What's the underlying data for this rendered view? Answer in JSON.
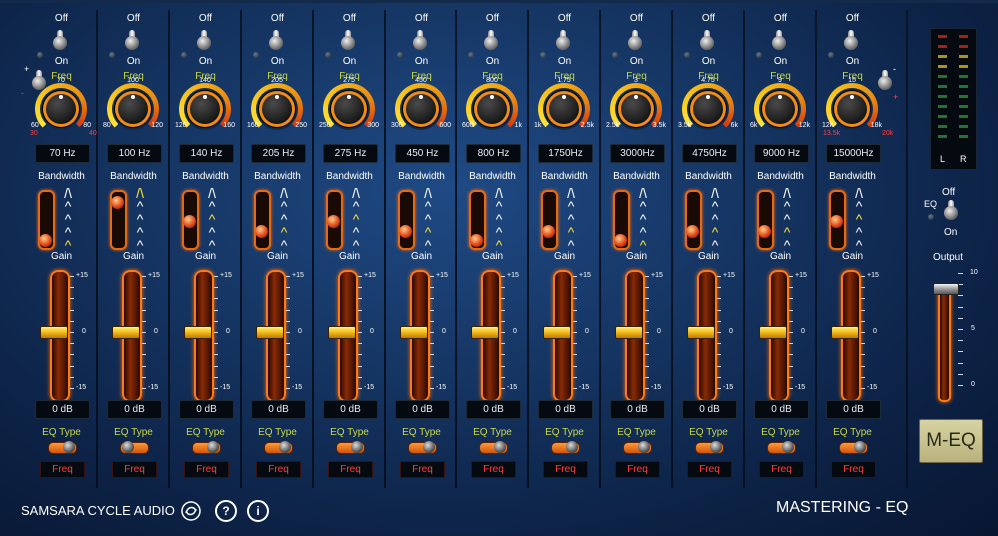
{
  "app": {
    "brand": "SAMSARA CYCLE AUDIO",
    "title": "MASTERING - EQ",
    "logo": "M-EQ"
  },
  "labels": {
    "off": "Off",
    "on": "On",
    "freq": "Freq",
    "bandwidth": "Bandwidth",
    "gain": "Gain",
    "eq_type": "EQ Type",
    "eq": "EQ",
    "output": "Output",
    "plus": "+",
    "minus": "-",
    "gain_scale": [
      "+15",
      "0",
      "-15"
    ],
    "meter": {
      "left": "L",
      "right": "R"
    },
    "output_scale": [
      "10",
      "5",
      "0"
    ]
  },
  "bands": [
    {
      "freq_value": "70",
      "freq_min": "60",
      "freq_max": "80",
      "range_min": "30",
      "range_max": "40",
      "readout": "70  Hz",
      "gain_readout": "0  dB",
      "eq_type": "Freq",
      "bandwidth_level": 1,
      "gain_db": 0,
      "eq_switch": "right",
      "toggle": "off"
    },
    {
      "freq_value": "100",
      "freq_min": "80",
      "freq_max": "120",
      "readout": "100 Hz",
      "gain_readout": "0  dB",
      "eq_type": "Freq",
      "bandwidth_level": 5,
      "gain_db": 0,
      "eq_switch": "left",
      "toggle": "off"
    },
    {
      "freq_value": "140",
      "freq_min": "120",
      "freq_max": "160",
      "readout": "140 Hz",
      "gain_readout": "0  dB",
      "eq_type": "Freq",
      "bandwidth_level": 3,
      "gain_db": 0,
      "eq_switch": "right",
      "toggle": "off"
    },
    {
      "freq_value": "205",
      "freq_min": "160",
      "freq_max": "250",
      "readout": "205 Hz",
      "gain_readout": "0  dB",
      "eq_type": "Freq",
      "bandwidth_level": 2,
      "gain_db": 0,
      "eq_switch": "right",
      "toggle": "off"
    },
    {
      "freq_value": "275",
      "freq_min": "250",
      "freq_max": "300",
      "readout": "275 Hz",
      "gain_readout": "0  dB",
      "eq_type": "Freq",
      "bandwidth_level": 3,
      "gain_db": 0,
      "eq_switch": "right",
      "toggle": "off"
    },
    {
      "freq_value": "450",
      "freq_min": "300",
      "freq_max": "600",
      "readout": "450 Hz",
      "gain_readout": "0  dB",
      "eq_type": "Freq",
      "bandwidth_level": 2,
      "gain_db": 0,
      "eq_switch": "right",
      "toggle": "off"
    },
    {
      "freq_value": "800",
      "freq_min": "600",
      "freq_max": "1k",
      "readout": "800 Hz",
      "gain_readout": "0  dB",
      "eq_type": "Freq",
      "bandwidth_level": 1,
      "gain_db": 0,
      "eq_switch": "right",
      "toggle": "off"
    },
    {
      "freq_value": "1.75",
      "freq_min": "1k",
      "freq_max": "2.5k",
      "readout": "1750Hz",
      "gain_readout": "0  dB",
      "eq_type": "Freq",
      "bandwidth_level": 2,
      "gain_db": 0,
      "eq_switch": "right",
      "toggle": "off"
    },
    {
      "freq_value": "3",
      "freq_min": "2.5k",
      "freq_max": "3.5k",
      "readout": "3000Hz",
      "gain_readout": "0  dB",
      "eq_type": "Freq",
      "bandwidth_level": 1,
      "gain_db": 0,
      "eq_switch": "right",
      "toggle": "off"
    },
    {
      "freq_value": "4.75",
      "freq_min": "3.5k",
      "freq_max": "6k",
      "readout": "4750Hz",
      "gain_readout": "0  dB",
      "eq_type": "Freq",
      "bandwidth_level": 2,
      "gain_db": 0,
      "eq_switch": "right",
      "toggle": "off"
    },
    {
      "freq_value": "9",
      "freq_min": "6k",
      "freq_max": "12k",
      "readout": "9000 Hz",
      "gain_readout": "0  dB",
      "eq_type": "Freq",
      "bandwidth_level": 2,
      "gain_db": 0,
      "eq_switch": "right",
      "toggle": "off"
    },
    {
      "freq_value": "15",
      "freq_min": "12k",
      "freq_max": "18k",
      "range_min": "13.5k",
      "range_max": "20k",
      "readout": "15000Hz",
      "gain_readout": "0  dB",
      "eq_type": "Freq",
      "bandwidth_level": 3,
      "gain_db": 0,
      "eq_switch": "right",
      "toggle": "off"
    }
  ],
  "output_level": 9.1,
  "eq_master": "off",
  "colors": {
    "accent_orange": "#ff7a14",
    "label_green": "#c7d84a",
    "freq_red": "#ff4040",
    "thumb_yellow": "#f0b81a"
  },
  "icons": [
    "cycle-logo-icon",
    "help-icon",
    "info-icon"
  ]
}
